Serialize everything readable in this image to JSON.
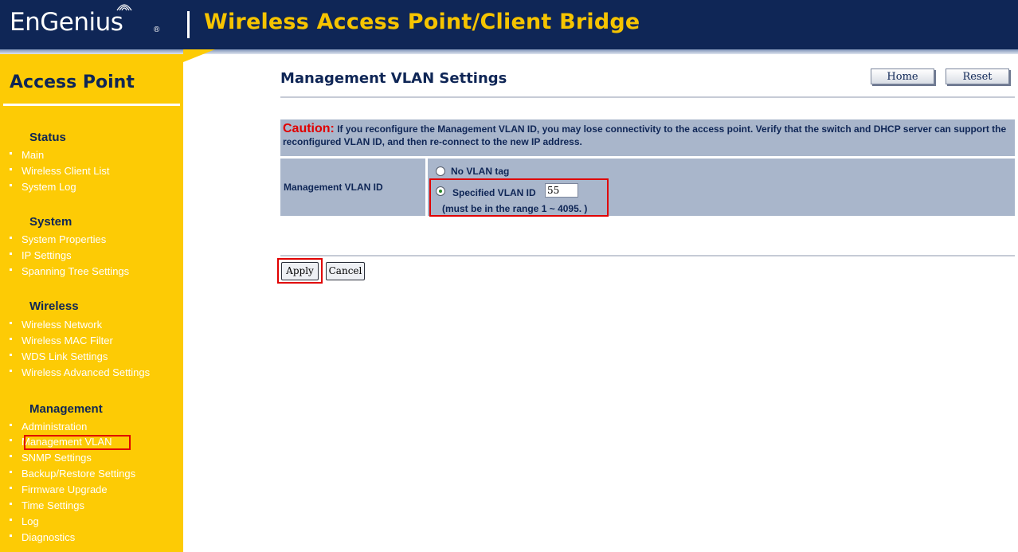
{
  "header": {
    "logo": "EnGenius",
    "logo_mark": "®",
    "title": "Wireless Access Point/Client Bridge"
  },
  "sidebar": {
    "title": "Access Point",
    "sections": [
      {
        "heading": "Status",
        "items": [
          "Main",
          "Wireless Client List",
          "System Log"
        ]
      },
      {
        "heading": "System",
        "items": [
          "System Properties",
          "IP Settings",
          "Spanning Tree Settings"
        ]
      },
      {
        "heading": "Wireless",
        "items": [
          "Wireless Network",
          "Wireless MAC Filter",
          "WDS Link Settings",
          "Wireless Advanced Settings"
        ]
      },
      {
        "heading": "Management",
        "items": [
          "Administration",
          "Management VLAN",
          "SNMP Settings",
          "Backup/Restore Settings",
          "Firmware Upgrade",
          "Time Settings",
          "Log",
          "Diagnostics"
        ]
      }
    ],
    "active_item": "Management VLAN"
  },
  "main": {
    "page_title": "Management VLAN Settings",
    "home_button": "Home",
    "reset_button": "Reset",
    "caution_label": "Caution:",
    "caution_text": "If you reconfigure the Management VLAN ID, you may lose connectivity to the access point. Verify that the switch and DHCP server can support the reconfigured VLAN ID, and then re-connect to the new IP address.",
    "vlan_label": "Management VLAN ID",
    "option_no_tag": "No VLAN tag",
    "option_specified": "Specified VLAN ID",
    "vlan_id_value": "55",
    "range_note_prefix": "(must be in the range ",
    "range_min": "1",
    "range_sep": " ~ ",
    "range_max": "4095.",
    "range_note_suffix": " )",
    "apply_button": "Apply",
    "cancel_button": "Cancel"
  },
  "colors": {
    "header_bg": "#0f2656",
    "header_title": "#f6c400",
    "sidebar_bg": "#fdcb05",
    "table_bg": "#a9b6cb",
    "highlight": "#e00000"
  }
}
